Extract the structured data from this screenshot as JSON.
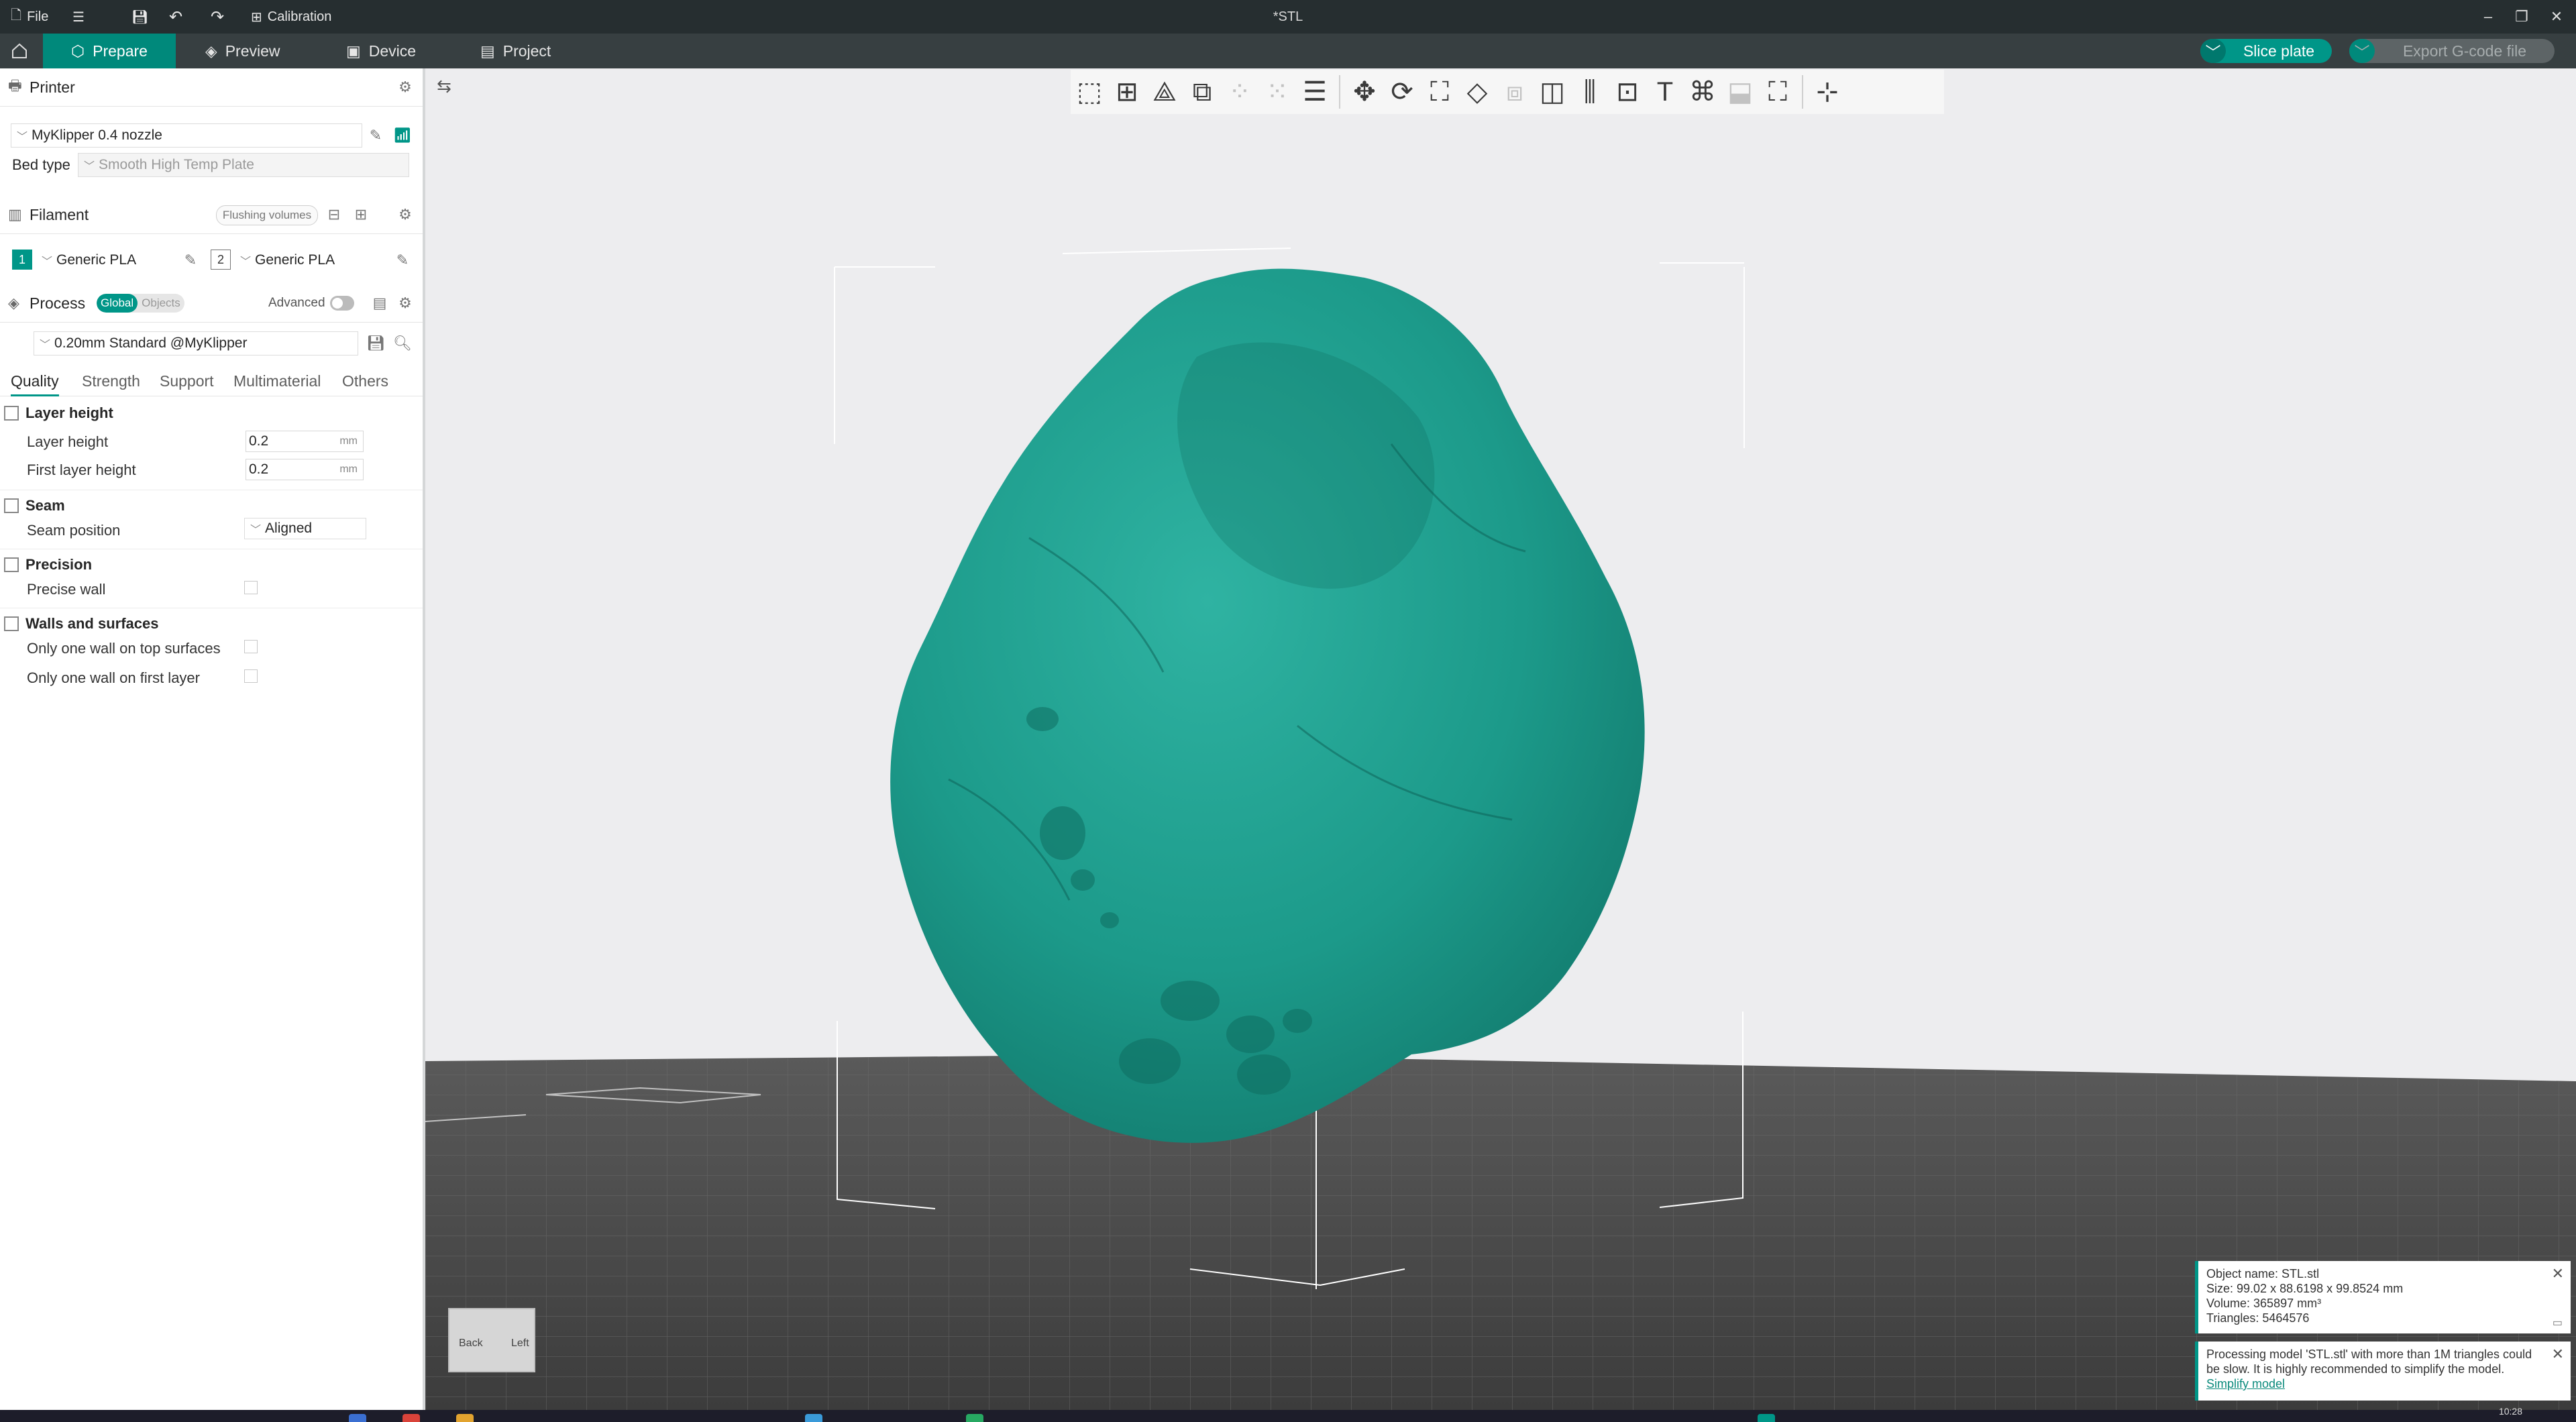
{
  "titlebar": {
    "file_label": "File",
    "calibration_label": "Calibration",
    "document_title": "*STL"
  },
  "nav": {
    "tabs": [
      {
        "label": "Prepare"
      },
      {
        "label": "Preview"
      },
      {
        "label": "Device"
      },
      {
        "label": "Project"
      }
    ],
    "slice_label": "Slice plate",
    "export_label": "Export G-code file"
  },
  "sidebar": {
    "printer": {
      "title": "Printer",
      "preset": "MyKlipper 0.4 nozzle",
      "bed_type_label": "Bed type",
      "bed_type_value": "Smooth High Temp Plate"
    },
    "filament": {
      "title": "Filament",
      "flushing_label": "Flushing volumes",
      "slots": [
        {
          "number": "1",
          "name": "Generic PLA",
          "color": "#009688"
        },
        {
          "number": "2",
          "name": "Generic PLA",
          "color": "#ffffff"
        }
      ]
    },
    "process": {
      "title": "Process",
      "seg_global": "Global",
      "seg_objects": "Objects",
      "advanced_label": "Advanced",
      "preset": "0.20mm Standard @MyKlipper"
    },
    "tabs": [
      "Quality",
      "Strength",
      "Support",
      "Multimaterial",
      "Others"
    ],
    "groups": {
      "layer_height": {
        "title": "Layer height",
        "layer_height_label": "Layer height",
        "layer_height_value": "0.2",
        "first_layer_label": "First layer height",
        "first_layer_value": "0.2",
        "unit": "mm"
      },
      "seam": {
        "title": "Seam",
        "seam_position_label": "Seam position",
        "seam_position_value": "Aligned"
      },
      "precision": {
        "title": "Precision",
        "precise_wall_label": "Precise wall"
      },
      "walls": {
        "title": "Walls and surfaces",
        "one_wall_top_label": "Only one wall on top surfaces",
        "one_wall_first_label": "Only one wall on first layer"
      }
    }
  },
  "viewport": {
    "navcube": {
      "back": "Back",
      "left": "Left"
    },
    "object_info": {
      "name": "Object name: STL.stl",
      "size": "Size: 99.02 x 88.6198 x 99.8524 mm",
      "volume": "Volume: 365897 mm³",
      "triangles": "Triangles: 5464576"
    },
    "notice": {
      "text": "Processing model 'STL.stl' with more than 1M triangles could be slow. It is highly recommended to simplify the model.",
      "link": "Simplify model"
    }
  },
  "taskbar": {
    "clock": "10:28"
  },
  "colors": {
    "accent": "#009688",
    "model": "#1e9a8a",
    "nav_bg": "#373f41"
  }
}
